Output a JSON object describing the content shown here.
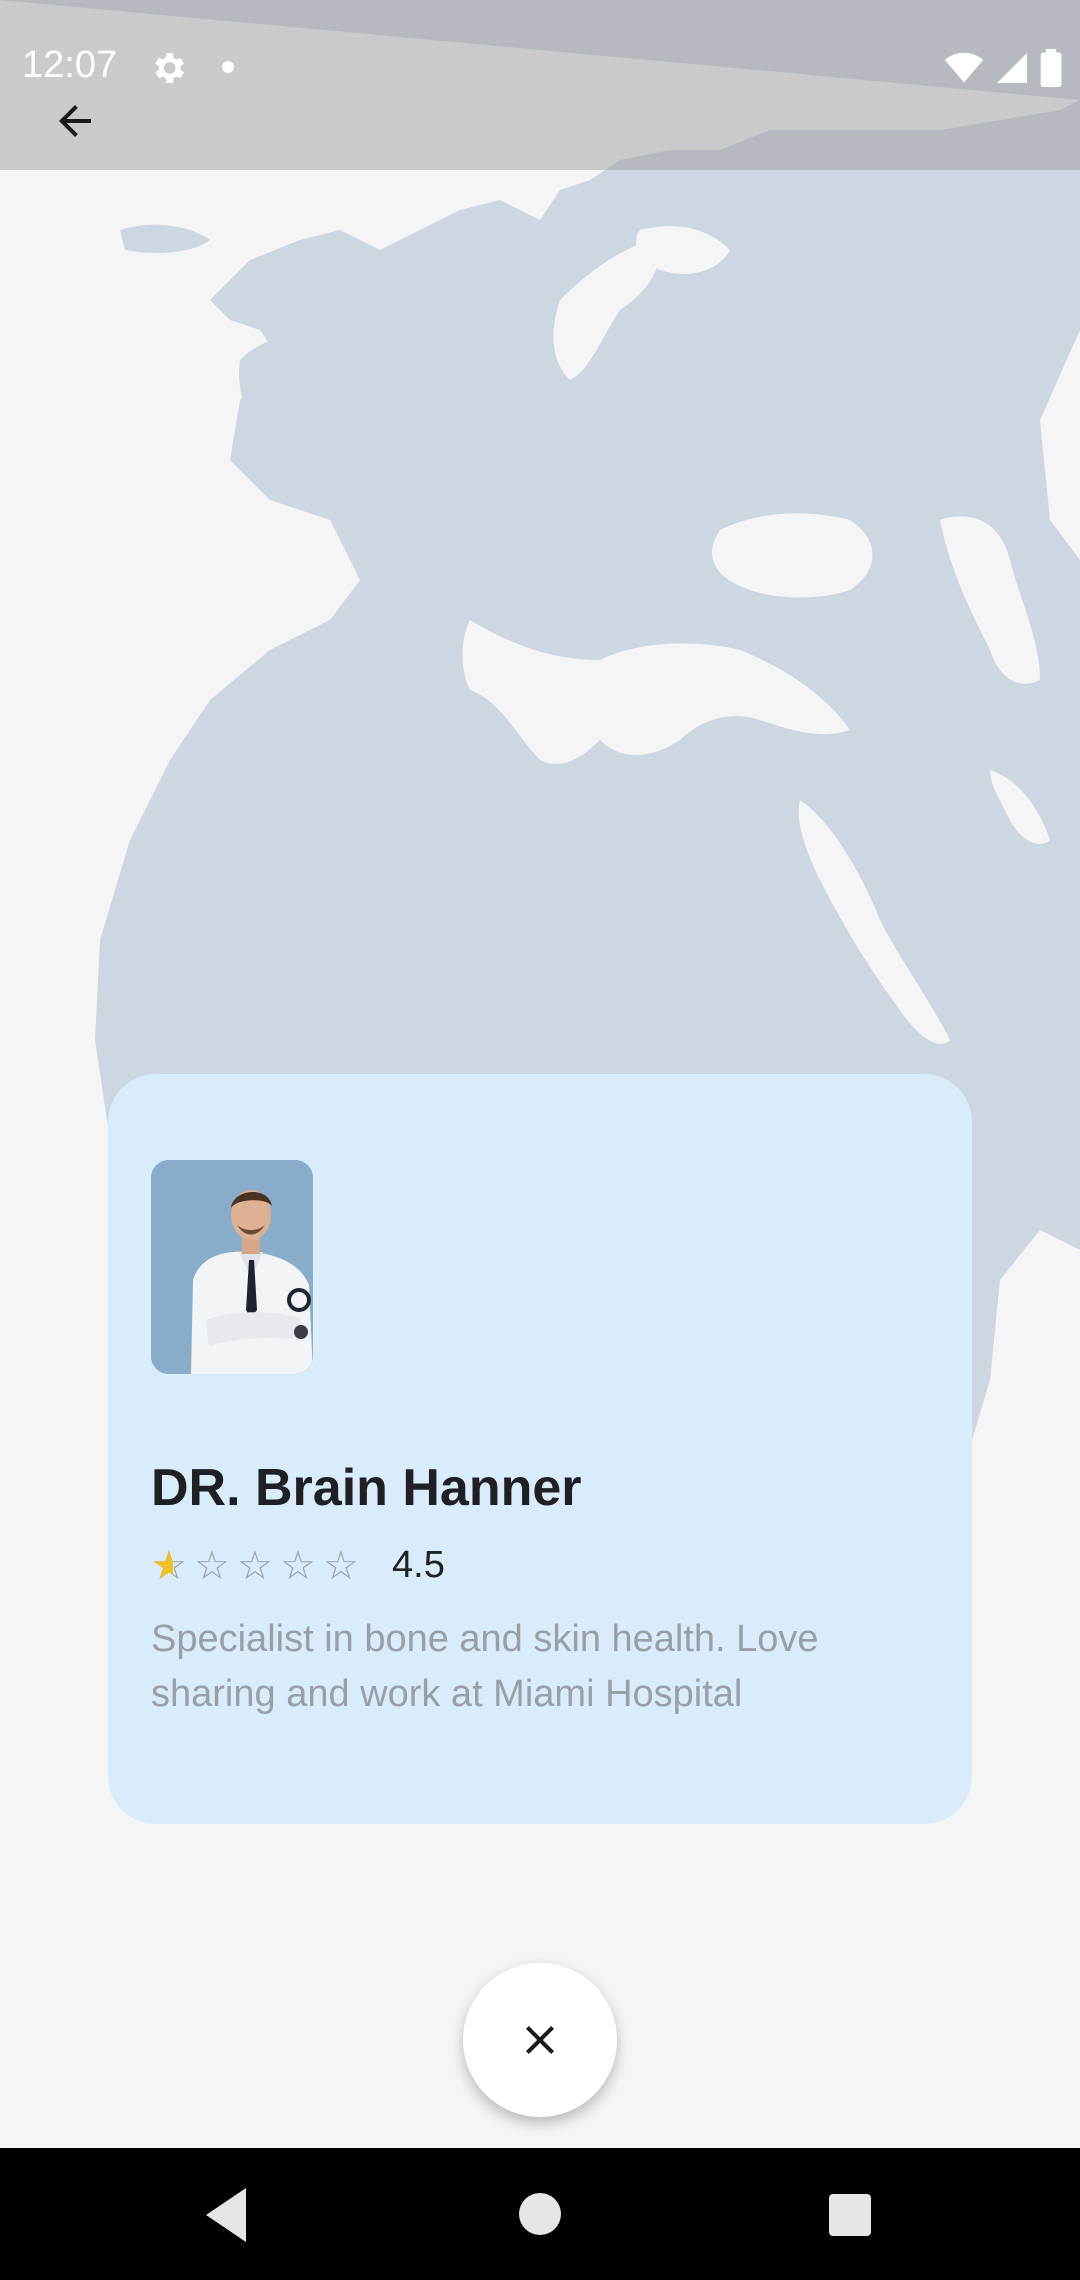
{
  "status_bar": {
    "time": "12:07",
    "icons": [
      "settings-icon",
      "notification-dot-icon",
      "wifi-icon",
      "signal-icon",
      "battery-icon"
    ]
  },
  "toolbar": {
    "back_icon": "arrow-back-icon"
  },
  "doctor_card": {
    "name": "DR. Brain Hanner",
    "rating_value": "4.5",
    "stars_total": 5,
    "stars_filled": 0.5,
    "description": "Specialist in bone and skin health. Love sharing and work at Miami Hospital",
    "colors": {
      "card_bg": "#d8ecfb",
      "star_filled": "#f2c024",
      "star_empty": "#9aa0a6"
    }
  },
  "fab": {
    "icon": "close-icon"
  },
  "nav_bar": {
    "icons": [
      "nav-back-icon",
      "nav-home-icon",
      "nav-recents-icon"
    ]
  }
}
